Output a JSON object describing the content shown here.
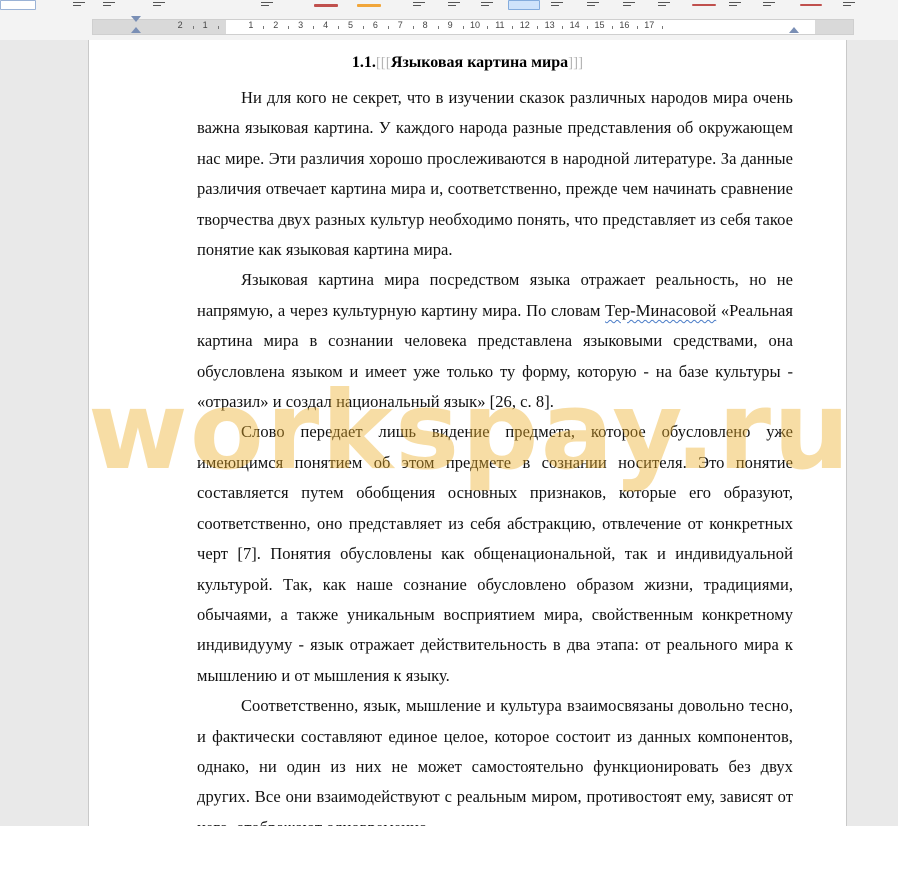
{
  "ruler": {
    "numbers": [
      "2",
      "1",
      "1",
      "2",
      "3",
      "4",
      "5",
      "6",
      "7",
      "8",
      "9",
      "10",
      "11",
      "12",
      "13",
      "14",
      "15",
      "16",
      "17"
    ]
  },
  "document": {
    "heading_number": "1.1.",
    "heading_text": "Языковая картина мира",
    "paragraphs": [
      {
        "text_before": "Ни для кого не секрет, что в изучении сказок различных народов мира очень важна языковая картина. У каждого народа разные представления об окружающем нас мире. Эти различия хорошо прослеживаются в народной литературе. За данные различия отвечает картина мира и, соответственно, прежде чем начинать сравнение творчества двух разных культур необходимо понять, что представляет из себя такое понятие как языковая картина мира.",
        "spelling_flag": "",
        "text_after": ""
      },
      {
        "text_before": "Языковая картина мира посредством языка отражает реальность, но не напрямую, а через культурную картину мира. По словам ",
        "spelling_flag": "Тер-Минасовой",
        "text_after": " «Реальная картина мира в сознании человека представлена языковыми средствами, она обусловлена языком и имеет уже только ту форму, которую - на базе культуры - «отразил» и создал национальный язык» [26, с. 8]."
      },
      {
        "text_before": "Слово передает лишь видение предмета, которое обусловлено уже имеющимся понятием об этом предмете в сознании носителя. Это понятие составляется путем обобщения основных признаков, которые его образуют, соответственно, оно представляет из себя абстракцию, отвлечение от конкретных черт [7]. Понятия обусловлены как общенациональной, так и индивидуальной культурой. Так, как наше сознание обусловлено образом жизни, традициями, обычаями, а также уникальным восприятием мира, свойственным конкретному индивидууму - язык отражает действительность в два этапа: от реального мира к мышлению и от мышления к языку.",
        "spelling_flag": "",
        "text_after": ""
      },
      {
        "text_before": "Соответственно, язык, мышление и культура взаимосвязаны довольно тесно, и фактически составляют единое целое, которое состоит из данных компонентов, однако, ни один из них не может самостоятельно функционировать без двух других. Все они взаимодействуют с реальным миром, противостоят ему, зависят от него, отображают одновременно",
        "spelling_flag": "",
        "text_after": ""
      }
    ]
  },
  "watermark": "workspay.ru",
  "colors": {
    "watermark": "#EBAF28",
    "spell_underline": "#4A7CC7",
    "ruler_marker": "#7A8FB5"
  }
}
